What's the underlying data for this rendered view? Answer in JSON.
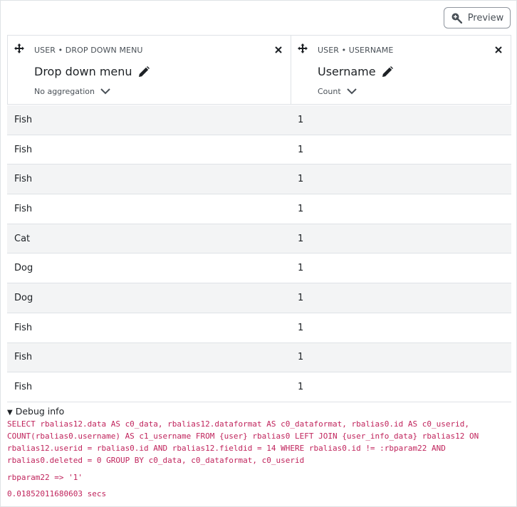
{
  "toolbar": {
    "preview_label": "Preview"
  },
  "columns": [
    {
      "source": "USER • DROP DOWN MENU",
      "title": "Drop down menu",
      "aggregation": "No aggregation"
    },
    {
      "source": "USER • USERNAME",
      "title": "Username",
      "aggregation": "Count"
    }
  ],
  "rows": [
    {
      "menu": "Fish",
      "count": "1"
    },
    {
      "menu": "Fish",
      "count": "1"
    },
    {
      "menu": "Fish",
      "count": "1"
    },
    {
      "menu": "Fish",
      "count": "1"
    },
    {
      "menu": "Cat",
      "count": "1"
    },
    {
      "menu": "Dog",
      "count": "1"
    },
    {
      "menu": "Dog",
      "count": "1"
    },
    {
      "menu": "Fish",
      "count": "1"
    },
    {
      "menu": "Fish",
      "count": "1"
    },
    {
      "menu": "Fish",
      "count": "1"
    }
  ],
  "debug": {
    "summary": "Debug info",
    "sql": "SELECT rbalias12.data AS c0_data, rbalias12.dataformat AS c0_dataformat, rbalias0.id AS c0_userid, COUNT(rbalias0.username) AS c1_username FROM {user} rbalias0 LEFT JOIN {user_info_data} rbalias12 ON rbalias12.userid = rbalias0.id AND rbalias12.fieldid = 14 WHERE rbalias0.id != :rbparam22 AND rbalias0.deleted = 0 GROUP BY c0_data, c0_dataformat, c0_userid",
    "params": "rbparam22 => '1'",
    "time": "0.01852011680603 secs"
  },
  "colors": {
    "sql_text": "#c0245c",
    "alt_row": "#f3f4f5",
    "border": "#dee2e6"
  }
}
